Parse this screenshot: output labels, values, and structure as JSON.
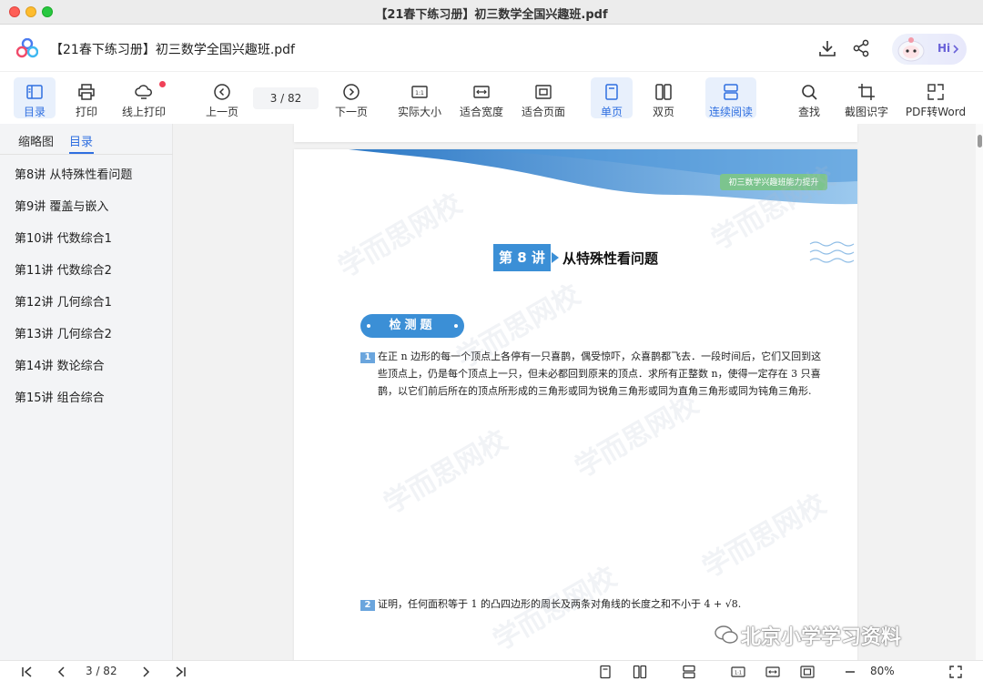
{
  "window": {
    "title": "【21春下练习册】初三数学全国兴趣班.pdf"
  },
  "header": {
    "filename": "【21春下练习册】初三数学全国兴趣班.pdf",
    "assistant_label": "Hi"
  },
  "toolbar": {
    "toc": "目录",
    "print": "打印",
    "online_print": "线上打印",
    "prev_page": "上一页",
    "page_indicator": "3  /  82",
    "next_page": "下一页",
    "actual_size": "实际大小",
    "fit_width": "适合宽度",
    "fit_page": "适合页面",
    "single_page": "单页",
    "double_page": "双页",
    "continuous": "连续阅读",
    "search": "查找",
    "ocr": "截图识字",
    "pdf_to_word": "PDF转Word"
  },
  "sidebar": {
    "tab_thumbnails": "缩略图",
    "tab_toc": "目录",
    "items": [
      "第8讲 从特殊性看问题",
      "第9讲 覆盖与嵌入",
      "第10讲 代数综合1",
      "第11讲 代数综合2",
      "第12讲 几何综合1",
      "第13讲 几何综合2",
      "第14讲 数论综合",
      "第15讲 组合综合"
    ]
  },
  "page": {
    "banner_badge": "初三数学兴趣班能力提升",
    "lecture_number": "第 8 讲",
    "lecture_title": "从特殊性看问题",
    "section_label": "检测题",
    "questions": [
      {
        "number": "1",
        "lines": [
          "在正 n 边形的每一个顶点上各停有一只喜鹊，偶受惊吓，众喜鹊都飞去．一段时间后，它们又回到这",
          "些顶点上，仍是每个顶点上一只，但未必都回到原来的顶点．求所有正整数 n，使得一定存在 3 只喜",
          "鹊，以它们前后所在的顶点所形成的三角形或同为锐角三角形或同为直角三角形或同为钝角三角形."
        ]
      },
      {
        "number": "2",
        "lines": [
          "证明，任何面积等于 1 的凸四边形的周长及两条对角线的长度之和不小于 4 + √8."
        ]
      }
    ],
    "watermark": "学而思网校"
  },
  "bottombar": {
    "page_indicator": "3  /  82",
    "zoom": "80%"
  },
  "overlay": {
    "wechat_watermark": "北京小学学习资料"
  },
  "colors": {
    "accent": "#2f6fe0",
    "brand_blue": "#3b8fd6",
    "active_bg": "#e8f0fc",
    "badge_green": "#7cc48e"
  }
}
